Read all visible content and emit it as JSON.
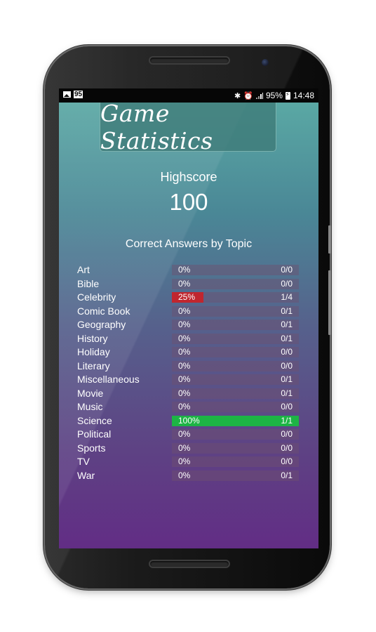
{
  "status_bar": {
    "notification_badge": "95",
    "battery": "95%",
    "time": "14:48",
    "icons": [
      "image-icon",
      "bluetooth-icon",
      "alarm-icon",
      "signal-icon",
      "battery-charging-icon"
    ]
  },
  "app": {
    "title": "Game Statistics",
    "highscore_label": "Highscore",
    "highscore_value": "100",
    "section_title": "Correct Answers by Topic"
  },
  "colors": {
    "bar_track": "#6e506e",
    "low_fill": "#c0262e",
    "full_fill": "#1db445",
    "gradient_top": "#5aa8a4",
    "gradient_bottom": "#622d85"
  },
  "topics": [
    {
      "name": "Art",
      "percent": "0%",
      "ratio": "0/0",
      "fraction": 0
    },
    {
      "name": "Bible",
      "percent": "0%",
      "ratio": "0/0",
      "fraction": 0
    },
    {
      "name": "Celebrity",
      "percent": "25%",
      "ratio": "1/4",
      "fraction": 0.25
    },
    {
      "name": "Comic Book",
      "percent": "0%",
      "ratio": "0/1",
      "fraction": 0
    },
    {
      "name": "Geography",
      "percent": "0%",
      "ratio": "0/1",
      "fraction": 0
    },
    {
      "name": "History",
      "percent": "0%",
      "ratio": "0/1",
      "fraction": 0
    },
    {
      "name": "Holiday",
      "percent": "0%",
      "ratio": "0/0",
      "fraction": 0
    },
    {
      "name": "Literary",
      "percent": "0%",
      "ratio": "0/0",
      "fraction": 0
    },
    {
      "name": "Miscellaneous",
      "percent": "0%",
      "ratio": "0/1",
      "fraction": 0
    },
    {
      "name": "Movie",
      "percent": "0%",
      "ratio": "0/1",
      "fraction": 0
    },
    {
      "name": "Music",
      "percent": "0%",
      "ratio": "0/0",
      "fraction": 0
    },
    {
      "name": "Science",
      "percent": "100%",
      "ratio": "1/1",
      "fraction": 1
    },
    {
      "name": "Political",
      "percent": "0%",
      "ratio": "0/0",
      "fraction": 0
    },
    {
      "name": "Sports",
      "percent": "0%",
      "ratio": "0/0",
      "fraction": 0
    },
    {
      "name": "TV",
      "percent": "0%",
      "ratio": "0/0",
      "fraction": 0
    },
    {
      "name": "War",
      "percent": "0%",
      "ratio": "0/1",
      "fraction": 0
    }
  ]
}
